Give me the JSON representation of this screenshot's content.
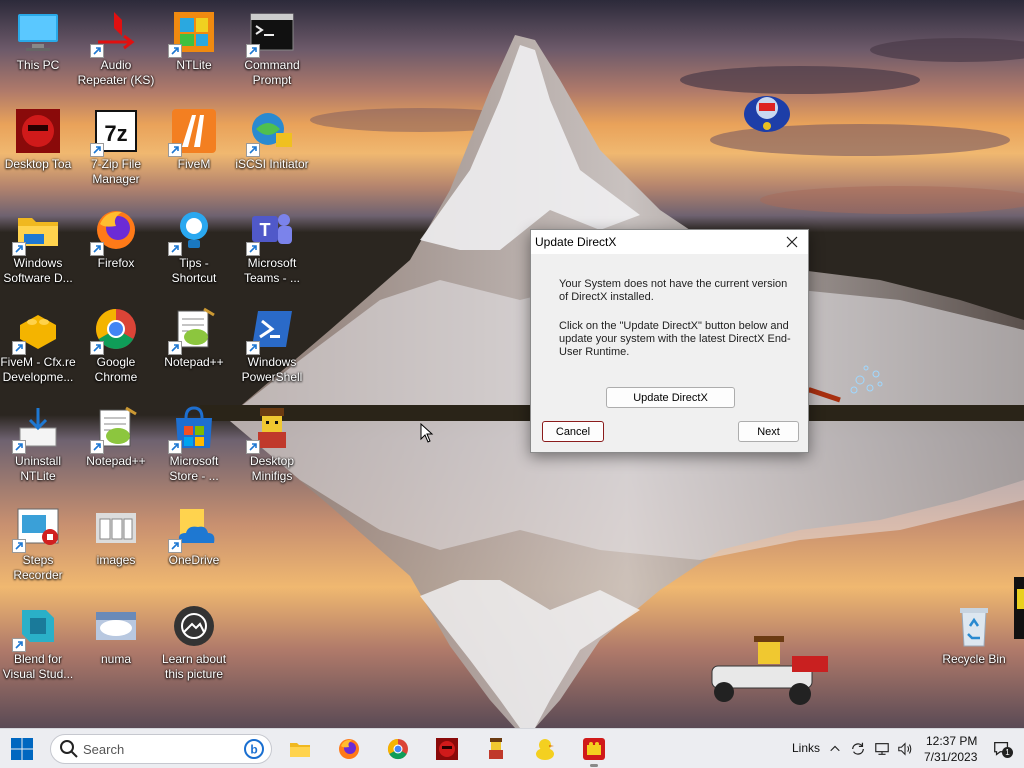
{
  "desktop": {
    "icons": [
      {
        "label": "This PC",
        "icon": "monitor-icon",
        "shortcut": false
      },
      {
        "label": "Audio\nRepeater (KS)",
        "icon": "audio-repeater-icon",
        "shortcut": true
      },
      {
        "label": "NTLite",
        "icon": "ntlite-icon",
        "shortcut": true
      },
      {
        "label": "Command\nPrompt",
        "icon": "cmd-icon",
        "shortcut": true
      },
      {
        "label": "Desktop Toa",
        "icon": "toa-icon",
        "shortcut": false
      },
      {
        "label": "7-Zip File\nManager",
        "icon": "7zip-icon",
        "shortcut": true
      },
      {
        "label": "FiveM",
        "icon": "fivem-icon",
        "shortcut": true
      },
      {
        "label": "iSCSI Initiator",
        "icon": "iscsi-icon",
        "shortcut": true
      },
      {
        "label": "Windows\nSoftware D...",
        "icon": "folder-icon",
        "shortcut": true
      },
      {
        "label": "Firefox",
        "icon": "firefox-icon",
        "shortcut": true
      },
      {
        "label": "Tips -\nShortcut",
        "icon": "tips-bulb-icon",
        "shortcut": true
      },
      {
        "label": "Microsoft\nTeams - ...",
        "icon": "teams-icon",
        "shortcut": true
      },
      {
        "label": "FiveM - Cfx.re\nDevelopme...",
        "icon": "lego-brick-icon",
        "shortcut": true
      },
      {
        "label": "Google\nChrome",
        "icon": "chrome-icon",
        "shortcut": true
      },
      {
        "label": "Notepad++",
        "icon": "notepadpp-icon",
        "shortcut": true
      },
      {
        "label": "Windows\nPowerShell",
        "icon": "powershell-icon",
        "shortcut": true
      },
      {
        "label": "Uninstall\nNTLite",
        "icon": "uninstall-icon",
        "shortcut": true
      },
      {
        "label": "Notepad++",
        "icon": "notepadpp-icon",
        "shortcut": true
      },
      {
        "label": "Microsoft\nStore - ...",
        "icon": "store-icon",
        "shortcut": true
      },
      {
        "label": "Desktop\nMinifigs",
        "icon": "minifig-icon",
        "shortcut": true
      },
      {
        "label": "Steps\nRecorder",
        "icon": "steps-recorder-icon",
        "shortcut": true
      },
      {
        "label": "images",
        "icon": "images-icon",
        "shortcut": false
      },
      {
        "label": "OneDrive",
        "icon": "onedrive-icon",
        "shortcut": true
      },
      {
        "label": "Blend for\nVisual Stud...",
        "icon": "blend-icon",
        "shortcut": true
      },
      {
        "label": "numa",
        "icon": "numa-icon",
        "shortcut": false
      },
      {
        "label": "Learn about\nthis picture",
        "icon": "camera-icon",
        "shortcut": false
      },
      {
        "label": "Recycle Bin",
        "icon": "recycle-bin-icon",
        "shortcut": false
      }
    ]
  },
  "dialog": {
    "title": "Update DirectX",
    "message1": "Your System does not have the current version of DirectX installed.",
    "message2": "Click on the \"Update DirectX\" button below and update your system with the latest DirectX End-User Runtime.",
    "update_label": "Update DirectX",
    "cancel_label": "Cancel",
    "next_label": "Next"
  },
  "taskbar": {
    "search_placeholder": "Search",
    "pinned": [
      "file-explorer-icon",
      "firefox-icon",
      "chrome-icon",
      "toa-icon",
      "minifig-icon",
      "duck-icon",
      "lego-app-icon"
    ],
    "links_label": "Links",
    "time": "12:37 PM",
    "date": "7/31/2023",
    "notification_count": "1"
  },
  "colors": {
    "accent": "#0067c0",
    "dialog_bg": "#f0f0f0",
    "cancel_border": "#8b1c1c",
    "taskbar_bg": "#ecedf1"
  }
}
